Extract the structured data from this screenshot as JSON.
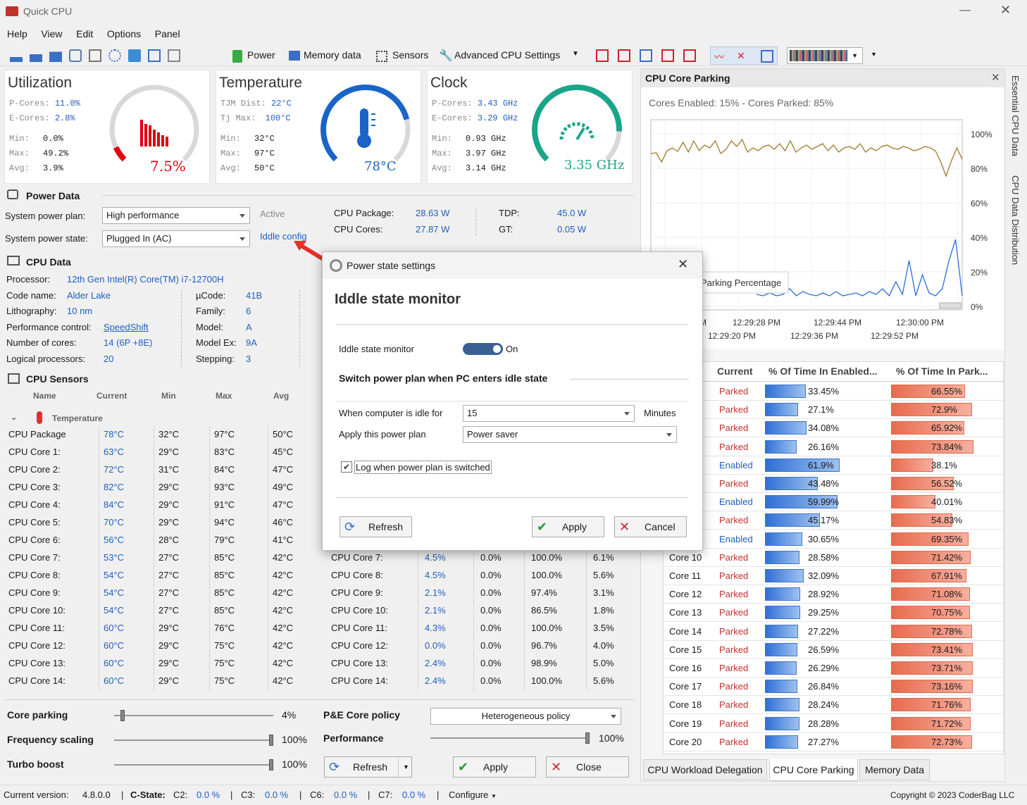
{
  "window": {
    "title": "Quick CPU"
  },
  "menu": [
    "Help",
    "View",
    "Edit",
    "Options",
    "Panel"
  ],
  "toolbar": {
    "power": "Power",
    "memory": "Memory data",
    "sensors": "Sensors",
    "advanced": "Advanced CPU Settings"
  },
  "utilization": {
    "title": "Utilization",
    "pcores_lbl": "P-Cores:",
    "pcores": "11.0%",
    "ecores_lbl": "E-Cores:",
    "ecores": "2.8%",
    "min_lbl": "Min:",
    "min": "0.0%",
    "max_lbl": "Max:",
    "max": "49.2%",
    "avg_lbl": "Avg:",
    "avg": "3.9%",
    "value": "7.5%",
    "level": 0.075
  },
  "temperature": {
    "title": "Temperature",
    "tjm_lbl": "TJM Dist:",
    "tjm": "22°C",
    "tj_lbl": "Tj Max:",
    "tj": "100°C",
    "min_lbl": "Min:",
    "min": "32°C",
    "max_lbl": "Max:",
    "max": "97°C",
    "avg_lbl": "Avg:",
    "avg": "50°C",
    "value": "78°C",
    "level": 0.78
  },
  "clock": {
    "title": "Clock",
    "pcores_lbl": "P-Cores:",
    "pcores": "3.43 GHz",
    "ecores_lbl": "E-Cores:",
    "ecores": "3.29 GHz",
    "min_lbl": "Min:",
    "min": "0.93 GHz",
    "max_lbl": "Max:",
    "max": "3.97 GHz",
    "avg_lbl": "Avg:",
    "avg": "3.14 GHz",
    "value": "3.35 GHz",
    "level": 0.84
  },
  "power": {
    "title": "Power Data",
    "plan_lbl": "System power plan:",
    "plan": "High performance",
    "state_lbl": "System power state:",
    "state": "Plugged In (AC)",
    "active": "Active",
    "iddle_link": "Iddle config",
    "pkg_lbl": "CPU Package:",
    "pkg": "28.63 W",
    "cores_lbl": "CPU Cores:",
    "cores": "27.87 W",
    "tdp_lbl": "TDP:",
    "tdp": "45.0 W",
    "gt_lbl": "GT:",
    "gt": "0.05 W"
  },
  "cpu": {
    "title": "CPU Data",
    "proc_lbl": "Processor:",
    "proc": "12th Gen Intel(R) Core(TM) i7-12700H",
    "code_lbl": "Code name:",
    "code": "Alder Lake",
    "litho_lbl": "Lithography:",
    "litho": "10 nm",
    "perf_lbl": "Performance control:",
    "perf": "SpeedShift",
    "ncores_lbl": "Number of cores:",
    "ncores": "14 (6P +8E)",
    "logical_lbl": "Logical processors:",
    "logical": "20",
    "ucode_lbl": "µCode:",
    "ucode": "41B",
    "family_lbl": "Family:",
    "family": "6",
    "model_lbl": "Model:",
    "model": "A",
    "modelex_lbl": "Model Ex:",
    "modelex": "9A",
    "stepping_lbl": "Stepping:",
    "stepping": "3"
  },
  "sensors": {
    "title": "CPU Sensors",
    "headers": [
      "Name",
      "Current",
      "Min",
      "Max",
      "Avg"
    ],
    "group": "Temperature",
    "rows": [
      [
        "CPU Package",
        "78°C",
        "32°C",
        "97°C",
        "50°C"
      ],
      [
        "CPU Core 1:",
        "63°C",
        "29°C",
        "83°C",
        "45°C"
      ],
      [
        "CPU Core 2:",
        "72°C",
        "31°C",
        "84°C",
        "47°C"
      ],
      [
        "CPU Core 3:",
        "82°C",
        "29°C",
        "93°C",
        "49°C"
      ],
      [
        "CPU Core 4:",
        "84°C",
        "29°C",
        "91°C",
        "47°C"
      ],
      [
        "CPU Core 5:",
        "70°C",
        "29°C",
        "94°C",
        "46°C"
      ],
      [
        "CPU Core 6:",
        "56°C",
        "28°C",
        "79°C",
        "41°C"
      ],
      [
        "CPU Core 7:",
        "53°C",
        "27°C",
        "85°C",
        "42°C"
      ],
      [
        "CPU Core 8:",
        "54°C",
        "27°C",
        "85°C",
        "42°C"
      ],
      [
        "CPU Core 9:",
        "54°C",
        "27°C",
        "85°C",
        "42°C"
      ],
      [
        "CPU Core 10:",
        "54°C",
        "27°C",
        "85°C",
        "42°C"
      ],
      [
        "CPU Core 11:",
        "60°C",
        "29°C",
        "76°C",
        "42°C"
      ],
      [
        "CPU Core 12:",
        "60°C",
        "29°C",
        "75°C",
        "42°C"
      ],
      [
        "CPU Core 13:",
        "60°C",
        "29°C",
        "75°C",
        "42°C"
      ],
      [
        "CPU Core 14:",
        "60°C",
        "29°C",
        "75°C",
        "42°C"
      ]
    ],
    "rows2": [
      [
        "CPU Core 7:",
        "4.5%",
        "0.0%",
        "100.0%",
        "6.1%"
      ],
      [
        "CPU Core 8:",
        "4.5%",
        "0.0%",
        "100.0%",
        "5.6%"
      ],
      [
        "CPU Core 9:",
        "2.1%",
        "0.0%",
        "97.4%",
        "3.1%"
      ],
      [
        "CPU Core 10:",
        "2.1%",
        "0.0%",
        "86.5%",
        "1.8%"
      ],
      [
        "CPU Core 11:",
        "4.3%",
        "0.0%",
        "100.0%",
        "3.5%"
      ],
      [
        "CPU Core 12:",
        "0.0%",
        "0.0%",
        "96.7%",
        "4.0%"
      ],
      [
        "CPU Core 13:",
        "2.4%",
        "0.0%",
        "98.9%",
        "5.0%"
      ],
      [
        "CPU Core 14:",
        "2.4%",
        "0.0%",
        "100.0%",
        "5.6%"
      ]
    ]
  },
  "controls": {
    "parking_lbl": "Core parking",
    "parking": "4%",
    "parking_level": 0.04,
    "freq_lbl": "Frequency scaling",
    "freq": "100%",
    "freq_level": 1.0,
    "turbo_lbl": "Turbo boost",
    "turbo": "100%",
    "turbo_level": 1.0,
    "policy_lbl": "P&E Core policy",
    "policy": "Heterogeneous policy",
    "perf_lbl": "Performance",
    "perf": "100%",
    "perf_level": 1.0,
    "refresh": "Refresh",
    "apply": "Apply",
    "close": "Close"
  },
  "status": {
    "version_lbl": "Current version:",
    "version": "4.8.0.0",
    "cstate_lbl": "C-State:",
    "c2_lbl": "C2:",
    "c2": "0.0 %",
    "c3_lbl": "C3:",
    "c3": "0.0 %",
    "c6_lbl": "C6:",
    "c6": "0.0 %",
    "c7_lbl": "C7:",
    "c7": "0.0 %",
    "configure": "Configure",
    "copyright": "Copyright © 2023 CoderBag LLC"
  },
  "parking": {
    "title": "CPU Core Parking",
    "summary": "Cores Enabled: 15% - Cores Parked: 85%",
    "legend": "Parking Percentage",
    "y_ticks": [
      "100%",
      "80%",
      "60%",
      "40%",
      "20%",
      "0%"
    ],
    "x_ticks_top": [
      "PM",
      "12:29:28 PM",
      "12:29:44 PM",
      "12:30:00 PM"
    ],
    "x_ticks_bottom": [
      "12:29:20 PM",
      "12:29:36 PM",
      "12:29:52 PM"
    ],
    "col_current": "Current",
    "col_enabled": "% Of Time In Enabled...",
    "col_parked": "% Of Time In Park...",
    "rows": [
      [
        "",
        "Parked",
        "33.45%",
        "66.55%",
        0.3345,
        0.6655
      ],
      [
        "",
        "Parked",
        "27.1%",
        "72.9%",
        0.271,
        0.729
      ],
      [
        "",
        "Parked",
        "34.08%",
        "65.92%",
        0.3408,
        0.6592
      ],
      [
        "",
        "Parked",
        "26.16%",
        "73.84%",
        0.2616,
        0.7384
      ],
      [
        "",
        "Enabled",
        "61.9%",
        "38.1%",
        0.619,
        0.381
      ],
      [
        "",
        "Parked",
        "43.48%",
        "56.52%",
        0.4348,
        0.5652
      ],
      [
        "",
        "Enabled",
        "59.99%",
        "40.01%",
        0.5999,
        0.4001
      ],
      [
        "",
        "Parked",
        "45.17%",
        "54.83%",
        0.4517,
        0.5483
      ],
      [
        "",
        "Enabled",
        "30.65%",
        "69.35%",
        0.3065,
        0.6935
      ],
      [
        "Core 10",
        "Parked",
        "28.58%",
        "71.42%",
        0.2858,
        0.7142
      ],
      [
        "Core 11",
        "Parked",
        "32.09%",
        "67.91%",
        0.3209,
        0.6791
      ],
      [
        "Core 12",
        "Parked",
        "28.92%",
        "71.08%",
        0.2892,
        0.7108
      ],
      [
        "Core 13",
        "Parked",
        "29.25%",
        "70.75%",
        0.2925,
        0.7075
      ],
      [
        "Core 14",
        "Parked",
        "27.22%",
        "72.78%",
        0.2722,
        0.7278
      ],
      [
        "Core 15",
        "Parked",
        "26.59%",
        "73.41%",
        0.2659,
        0.7341
      ],
      [
        "Core 16",
        "Parked",
        "26.29%",
        "73.71%",
        0.2629,
        0.7371
      ],
      [
        "Core 17",
        "Parked",
        "26.84%",
        "73.16%",
        0.2684,
        0.7316
      ],
      [
        "Core 18",
        "Parked",
        "28.24%",
        "71.76%",
        0.2824,
        0.7176
      ],
      [
        "Core 19",
        "Parked",
        "28.28%",
        "71.72%",
        0.2828,
        0.7172
      ],
      [
        "Core 20",
        "Parked",
        "27.27%",
        "72.73%",
        0.2727,
        0.7273
      ]
    ],
    "tabs": [
      "CPU Workload Delegation",
      "CPU Core Parking",
      "Memory Data"
    ]
  },
  "side_tabs": [
    "Essential CPU Data",
    "CPU Data Distribution"
  ],
  "dialog": {
    "title": "Power state settings",
    "heading": "Iddle state monitor",
    "monitor_lbl": "Iddle state monitor",
    "monitor_state": "On",
    "switch_lbl": "Switch power plan when PC enters idle state",
    "idle_lbl": "When computer is idle for",
    "idle_val": "15",
    "minutes": "Minutes",
    "plan_lbl": "Apply this power plan",
    "plan_val": "Power saver",
    "log_lbl": "Log when power plan is switched",
    "refresh": "Refresh",
    "apply": "Apply",
    "cancel": "Cancel"
  },
  "colors": {
    "accent": "#1f5fbf",
    "gauge_util": "#e0000f",
    "gauge_temp": "#1a64c8",
    "gauge_clock": "#1aa58a",
    "parked": "#c0322c",
    "chart_line": "#a0782e",
    "chart_line2": "#2a6fd6"
  }
}
